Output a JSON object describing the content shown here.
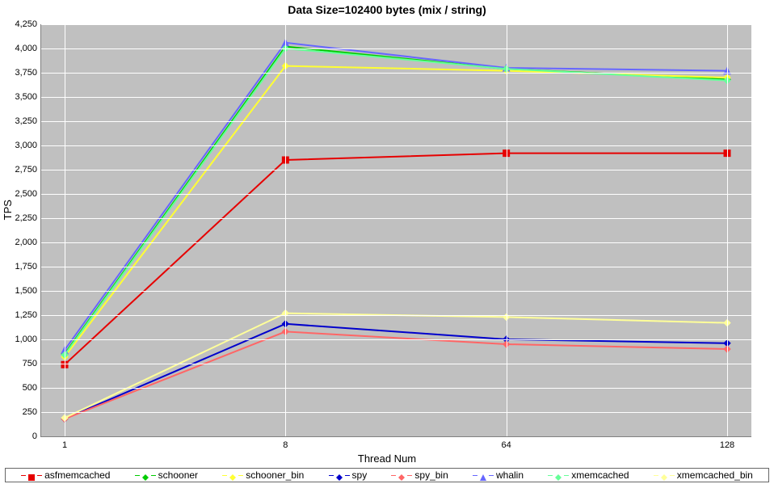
{
  "chart_data": {
    "type": "line",
    "title": "Data Size=102400 bytes (mix / string)",
    "xlabel": "Thread Num",
    "ylabel": "TPS",
    "ylim": [
      0,
      4250
    ],
    "yticks": [
      0,
      250,
      500,
      750,
      1000,
      1250,
      1500,
      1750,
      2000,
      2250,
      2500,
      2750,
      3000,
      3250,
      3500,
      3750,
      4000,
      4250
    ],
    "ytick_labels": [
      "0",
      "250",
      "500",
      "750",
      "1,000",
      "1,250",
      "1,500",
      "1,750",
      "2,000",
      "2,250",
      "2,500",
      "2,750",
      "3,000",
      "3,250",
      "3,500",
      "3,750",
      "4,000",
      "4,250"
    ],
    "categories": [
      "1",
      "8",
      "64",
      "128"
    ],
    "series": [
      {
        "name": "asfmemcached",
        "color": "#e60000",
        "shape": "square",
        "values": [
          740,
          2850,
          2920,
          2920
        ]
      },
      {
        "name": "schooner",
        "color": "#00cc00",
        "shape": "diamond",
        "values": [
          850,
          4020,
          3790,
          3680
        ]
      },
      {
        "name": "schooner_bin",
        "color": "#ffff33",
        "shape": "diamond",
        "values": [
          820,
          3820,
          3770,
          3700
        ]
      },
      {
        "name": "spy",
        "color": "#0000cc",
        "shape": "diamond",
        "values": [
          180,
          1160,
          1000,
          960
        ]
      },
      {
        "name": "spy_bin",
        "color": "#ff6666",
        "shape": "diamond",
        "values": [
          180,
          1080,
          950,
          900
        ]
      },
      {
        "name": "whalin",
        "color": "#6666ff",
        "shape": "triangle",
        "values": [
          890,
          4060,
          3800,
          3770
        ]
      },
      {
        "name": "xmemcached",
        "color": "#66ff99",
        "shape": "diamond",
        "values": [
          840,
          4000,
          3790,
          3670
        ]
      },
      {
        "name": "xmemcached_bin",
        "color": "#ffff99",
        "shape": "diamond",
        "values": [
          190,
          1270,
          1230,
          1170
        ]
      }
    ]
  }
}
